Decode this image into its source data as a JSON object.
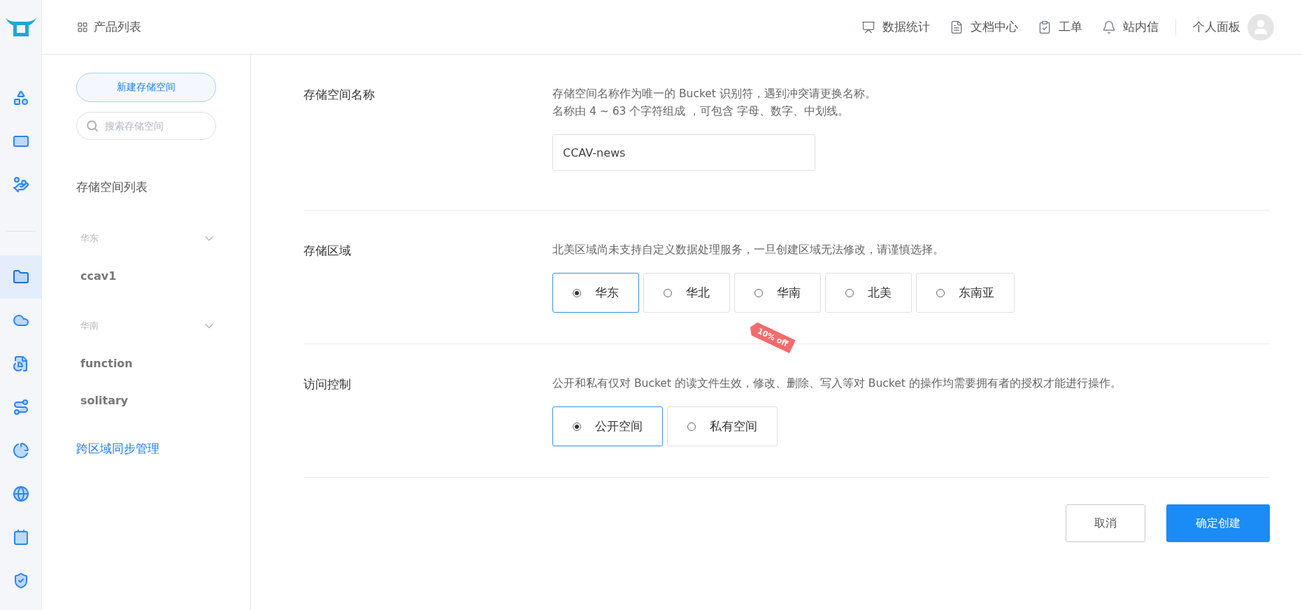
{
  "rail": {
    "items": [
      {
        "selected": false
      },
      {
        "selected": false
      },
      {
        "selected": false
      },
      {
        "selected": true
      },
      {
        "selected": false
      },
      {
        "selected": false
      },
      {
        "selected": false
      },
      {
        "selected": false
      },
      {
        "selected": false
      },
      {
        "selected": false
      },
      {
        "selected": false
      }
    ]
  },
  "header": {
    "product_list": "产品列表",
    "links": [
      "数据统计",
      "文档中心",
      "工单",
      "站内信"
    ],
    "user": "个人面板"
  },
  "sidebar": {
    "new_button": "新建存储空间",
    "search_placeholder": "搜索存储空间",
    "list_title": "存储空间列表",
    "groups": [
      {
        "region": "华东",
        "expanded": true,
        "buckets": [
          "ccav1"
        ]
      },
      {
        "region": "华南",
        "expanded": true,
        "buckets": [
          "function",
          "solitary"
        ]
      }
    ],
    "sync_link": "跨区域同步管理"
  },
  "form": {
    "sections": [
      {
        "kind": "input",
        "label": "存储空间名称",
        "hint": [
          "存储空间名称作为唯一的 Bucket 识别符，遇到冲突请更换名称。",
          "名称由 4 ~ 63 个字符组成 ，可包含 字母、数字、中划线。"
        ],
        "value": "CCAV-news"
      },
      {
        "kind": "radio",
        "label": "存储区域",
        "hint": [
          "北美区域尚未支持自定义数据处理服务，一旦创建区域无法修改，请谨慎选择。"
        ],
        "options": [
          {
            "label": "华东",
            "selected": true
          },
          {
            "label": "华北",
            "selected": false
          },
          {
            "label": "华南",
            "selected": false,
            "tag": "10% off"
          },
          {
            "label": "北美",
            "selected": false
          },
          {
            "label": "东南亚",
            "selected": false
          }
        ]
      },
      {
        "kind": "radio",
        "label": "访问控制",
        "hint": [
          "公开和私有仅对 Bucket 的读文件生效，修改、删除、写入等对 Bucket 的操作均需要拥有者的授权才能进行操作。"
        ],
        "options": [
          {
            "label": "公开空间",
            "selected": true
          },
          {
            "label": "私有空间",
            "selected": false
          }
        ]
      }
    ],
    "cancel": "取消",
    "confirm": "确定创建"
  }
}
